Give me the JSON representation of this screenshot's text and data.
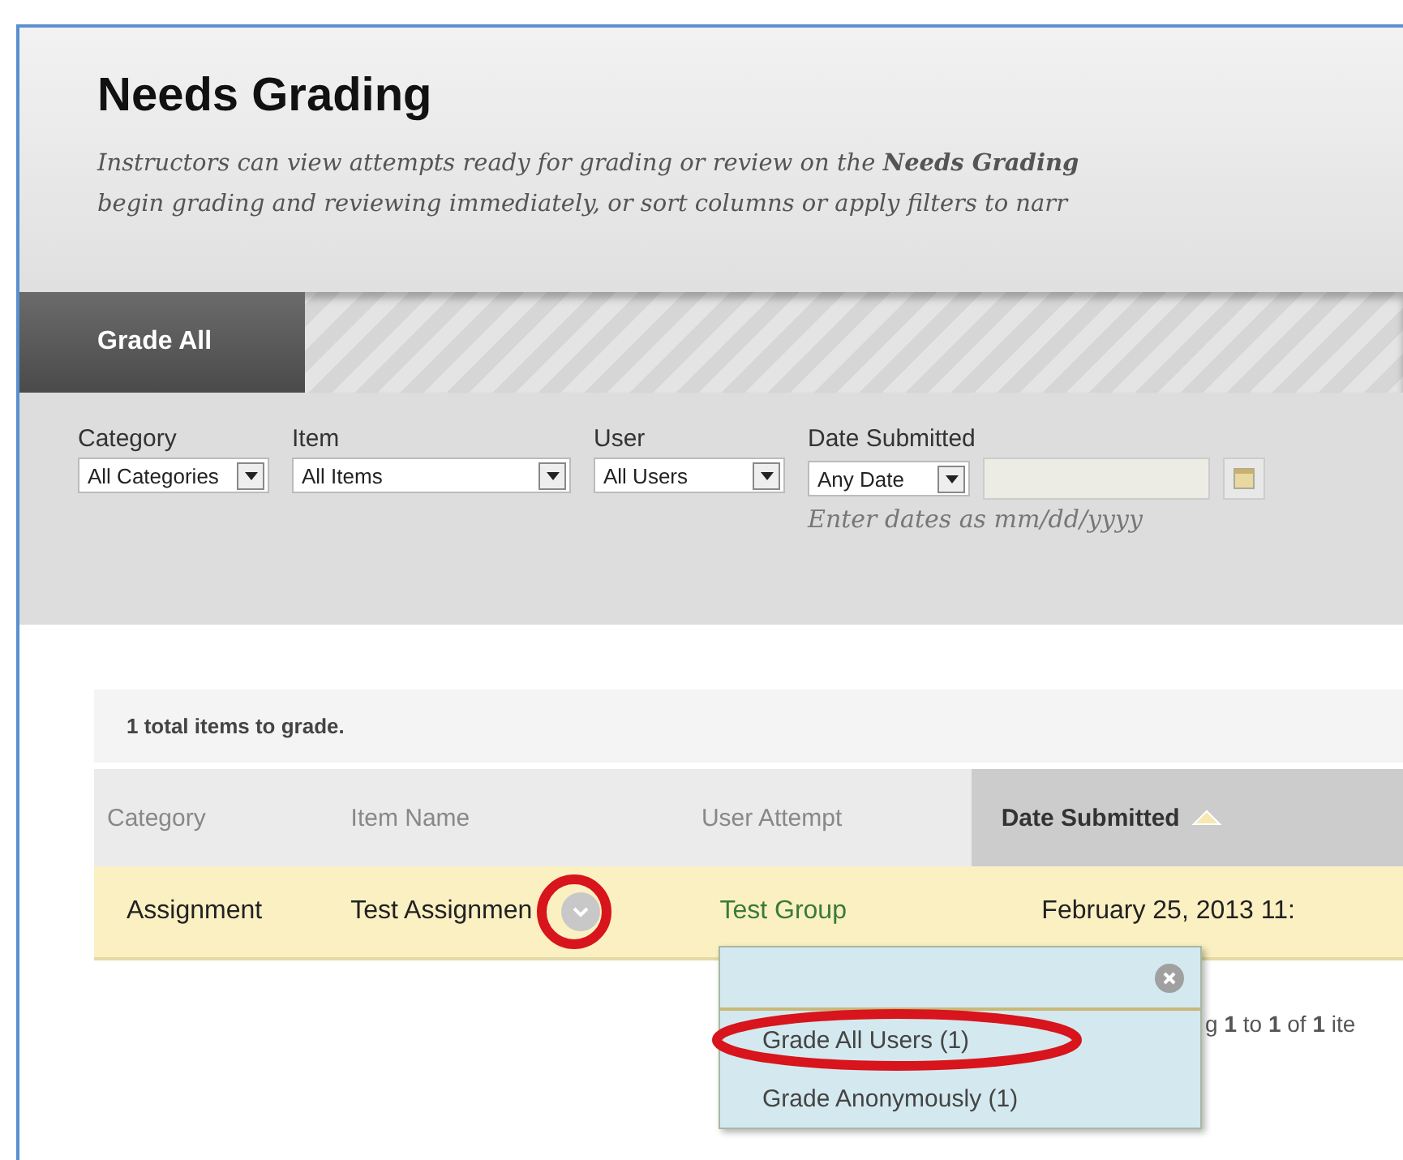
{
  "header": {
    "title": "Needs Grading",
    "description": [
      "Instructors can view attempts ready for grading or review on the **Needs Grading**",
      "begin grading and reviewing immediately, or sort columns or apply filters to narr"
    ]
  },
  "tabs": [
    {
      "label": "Grade All",
      "selected": true
    }
  ],
  "filters": [
    {
      "label": "Category",
      "value": "All Categories"
    },
    {
      "label": "Item",
      "value": "All Items"
    },
    {
      "label": "User",
      "value": "All Users"
    }
  ],
  "date_filter": {
    "label": "Date Submitted",
    "value": "Any Date",
    "hint": "Enter dates as mm/dd/yyyy"
  },
  "table": {
    "summary": "1 total items to grade.",
    "columns": [
      {
        "label": "Category",
        "sorted": false
      },
      {
        "label": "Item Name",
        "sorted": false
      },
      {
        "label": "User Attempt",
        "sorted": false
      },
      {
        "label": "Date Submitted",
        "sorted": true
      }
    ],
    "rows": [
      {
        "category": "Assignment",
        "item_name": "Test Assignmen",
        "user_attempt": "Test Group",
        "date_submitted": "February 25, 2013 11:"
      }
    ],
    "pagination": "g **1** to **1** of **1** ite"
  },
  "menu": {
    "items": [
      {
        "label": "Grade All Users (1)",
        "circled": true
      },
      {
        "label": "Grade Anonymously (1)",
        "circled": false
      }
    ]
  }
}
